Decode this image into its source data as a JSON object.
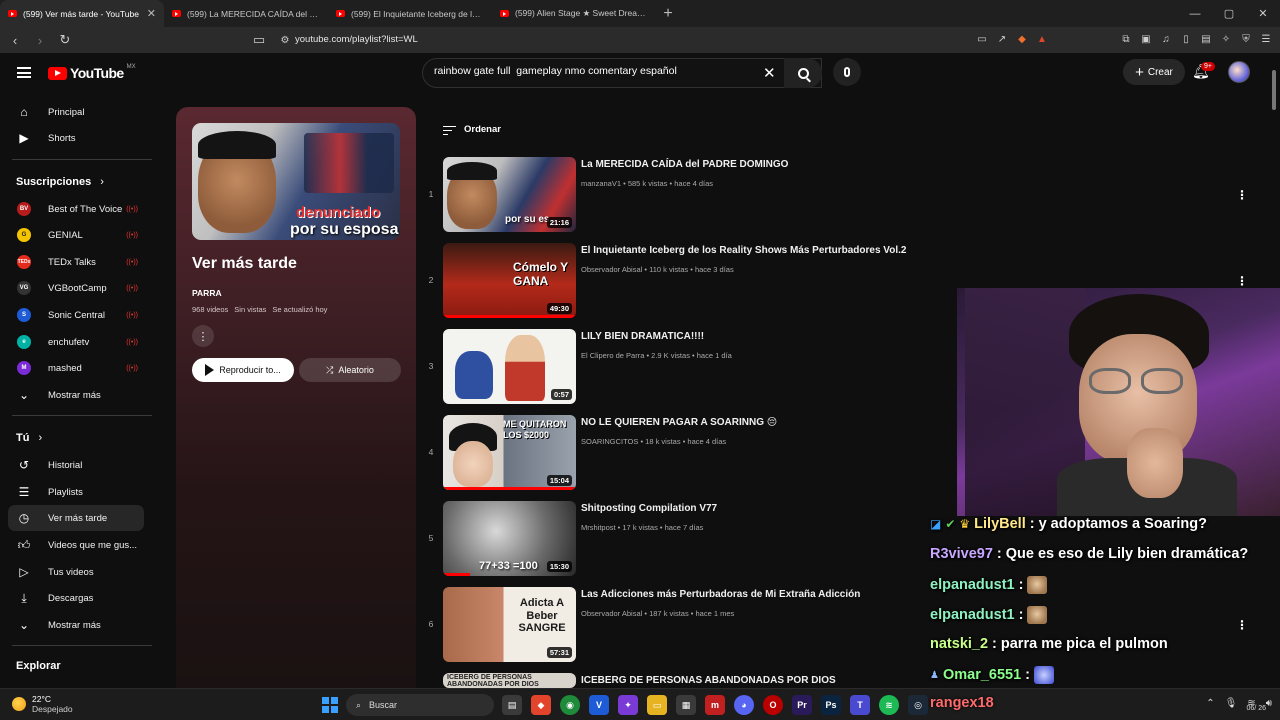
{
  "browser": {
    "tabs": [
      {
        "label": "(599) Ver más tarde - YouTube",
        "active": true
      },
      {
        "label": "(599) La MERECIDA CAÍDA del PADRE",
        "active": false
      },
      {
        "label": "(599) El Inquietante Iceberg de los R",
        "active": false
      },
      {
        "label": "(599) Alien Stage ★ Sweet Dream ☆",
        "active": false
      }
    ],
    "url": "youtube.com/playlist?list=WL"
  },
  "header": {
    "logo_word": "YouTube",
    "logo_country": "MX",
    "search_value": "rainbow gate full  gameplay nmo comentary español",
    "create_label": "Crear",
    "notif_badge": "9+"
  },
  "sidebar": {
    "main": [
      {
        "label": "Principal",
        "icon": "home-icon"
      },
      {
        "label": "Shorts",
        "icon": "shorts-icon"
      }
    ],
    "subs_heading": "Suscripciones",
    "subs": [
      {
        "label": "Best of The Voice",
        "abbr": "BV",
        "color": "#b71c1c"
      },
      {
        "label": "GENIAL",
        "abbr": "G",
        "color": "#f5c400"
      },
      {
        "label": "TEDx Talks",
        "abbr": "TEDx",
        "color": "#e62b1e"
      },
      {
        "label": "VGBootCamp",
        "abbr": "VG",
        "color": "#333333"
      },
      {
        "label": "Sonic Central",
        "abbr": "S",
        "color": "#1e5bd6"
      },
      {
        "label": "enchufetv",
        "abbr": "e",
        "color": "#00b3a4"
      },
      {
        "label": "mashed",
        "abbr": "M",
        "color": "#7a2bd6"
      }
    ],
    "subs_more": "Mostrar más",
    "you_heading": "Tú",
    "you": [
      {
        "label": "Historial",
        "icon": "history-icon"
      },
      {
        "label": "Playlists",
        "icon": "playlists-icon"
      },
      {
        "label": "Ver más tarde",
        "icon": "watch-later-icon",
        "active": true
      },
      {
        "label": "Videos que me gus...",
        "icon": "like-icon"
      },
      {
        "label": "Tus videos",
        "icon": "your-videos-icon"
      },
      {
        "label": "Descargas",
        "icon": "download-icon"
      },
      {
        "label": "Mostrar más",
        "icon": "chevron-down-icon"
      }
    ],
    "explore_heading": "Explorar"
  },
  "playlist": {
    "title": "Ver más tarde",
    "owner": "PARRA",
    "meta": [
      "968 videos",
      "Sin vistas",
      "Se actualizó hoy"
    ],
    "play_label": "Reproducir to...",
    "shuffle_label": "Aleatorio",
    "thumb_caption_1": "denunciado",
    "thumb_caption_2": "por su esposa"
  },
  "list": {
    "sort_label": "Ordenar",
    "videos": [
      {
        "index": "1",
        "title": "La MERECIDA CAÍDA del PADRE DOMINGO",
        "channel": "manzanaV1",
        "views": "585 k vistas",
        "age": "hace 4 días",
        "duration": "21:16",
        "progress": 0.0,
        "thumb_text": "por su es"
      },
      {
        "index": "2",
        "title": "El Inquietante Iceberg de los Reality Shows Más Perturbadores Vol.2",
        "channel": "Observador Abisal",
        "views": "110 k vistas",
        "age": "hace 3 días",
        "duration": "49:30",
        "progress": 1.0,
        "thumb_text": "Cómelo Y GANA"
      },
      {
        "index": "3",
        "title": "LILY BIEN DRAMATICA!!!!",
        "channel": "El Clipero de Parra",
        "views": "2.9 K vistas",
        "age": "hace 1 día",
        "duration": "0:57",
        "progress": 0.0,
        "thumb_text": ""
      },
      {
        "index": "4",
        "title": "NO LE QUIEREN PAGAR A SOARINNG 😔",
        "channel": "SOARINGCITOS",
        "views": "18 k vistas",
        "age": "hace 4 días",
        "duration": "15:04",
        "progress": 1.0,
        "thumb_text": "ME QUITARON LOS $2000"
      },
      {
        "index": "5",
        "title": "Shitposting Compilation V77",
        "channel": "Mrshitpost",
        "views": "17 k vistas",
        "age": "hace 7 días",
        "duration": "15:30",
        "progress": 0.2,
        "thumb_text": "77+33 =100"
      },
      {
        "index": "6",
        "title": "Las Adicciones más Perturbadoras de Mi Extraña Adicción",
        "channel": "Observador Abisal",
        "views": "187 k vistas",
        "age": "hace 1 mes",
        "duration": "57:31",
        "progress": 0.0,
        "thumb_text": "Adicta A Beber SANGRE"
      },
      {
        "index": "7",
        "title": "ICEBERG DE PERSONAS ABANDONADAS POR DIOS",
        "channel": "",
        "views": "",
        "age": "",
        "duration": "",
        "progress": 0.0,
        "thumb_text": "ICEBERG DE PERSONAS ABANDONADAS POR DIOS"
      }
    ]
  },
  "chat": [
    {
      "user": "LilyBell",
      "color": "#ffe88a",
      "msg": "y  adoptamos a Soaring?"
    },
    {
      "user": "R3vive97",
      "color": "#c9a6ff",
      "msg": "Que es eso de Lily bien dramática?"
    },
    {
      "user": "elpanadust1",
      "color": "#8ff0c0",
      "msg": ""
    },
    {
      "user": "elpanadust1",
      "color": "#8ff0c0",
      "msg": ""
    },
    {
      "user": "natski_2",
      "color": "#c8ff8a",
      "msg": "parra me pica el pulmon"
    },
    {
      "user": "Omar_6551",
      "color": "#8cff8c",
      "msg": ""
    },
    {
      "user": "rangex18",
      "color": "#ff6a6a",
      "msg": ""
    }
  ],
  "taskbar": {
    "temp": "22°C",
    "weather": "Despejado",
    "search_label": "Buscar",
    "clock": "06/ 26"
  },
  "colors": {
    "accent_red": "#ff0000",
    "bg": "#0f0f0f",
    "playlist_gradient_top": "#5a2830"
  }
}
